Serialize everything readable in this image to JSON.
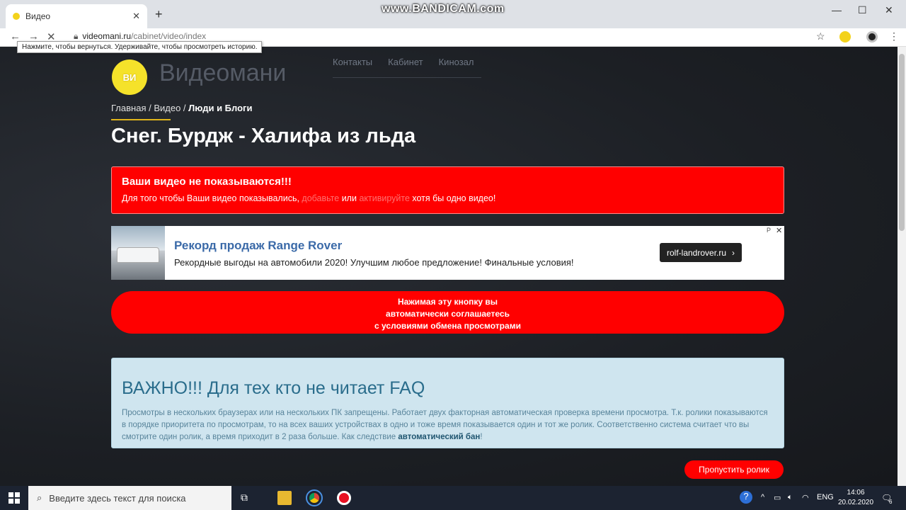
{
  "browser": {
    "tab_title": "Видео",
    "new_tab_icon": "+",
    "watermark": "www.BANDICAM.com",
    "url_host": "videomani.ru",
    "url_path": "/cabinet/video/index",
    "tooltip": "Нажмите, чтобы вернуться. Удерживайте, чтобы просмотреть историю."
  },
  "site": {
    "logo_text": "ВИ",
    "brand": "Видеомани",
    "nav": [
      "Контакты",
      "Кабинет",
      "Кинозал"
    ]
  },
  "breadcrumb": {
    "home": "Главная",
    "sep1": " / ",
    "video": "Видео",
    "sep2": " / ",
    "current": "Люди и Блоги"
  },
  "page_title": "Снег. Бурдж - Халифа из льда",
  "alert": {
    "title": "Ваши видео не показываются!!!",
    "text_start": "Для того чтобы Ваши видео показывались, ",
    "link_add": "добавьте",
    "text_or": " или ",
    "link_activate": "активируйте",
    "text_end": " хотя бы одно видео!"
  },
  "ad": {
    "title": "Рекорд продаж Range Rover",
    "text": "Рекордные выгоды на автомобили 2020! Улучшим любое предложение! Финальные условия!",
    "button": "rolf-landrover.ru",
    "button_arrow": "›",
    "mark": "Р",
    "close": "✕"
  },
  "agree_button": {
    "line1": "Нажимая эту кнопку вы",
    "line2": "автоматически соглашаетесь",
    "line3": "с условиями обмена просмотрами"
  },
  "info": {
    "title": "ВАЖНО!!! Для тех кто не читает FAQ",
    "text": "Просмотры в нескольких браузерах или на нескольких ПК запрещены. Работает двух факторная автоматическая проверка времени просмотра. Т.к. ролики показываются в порядке приоритета по просмотрам, то на всех ваших устройствах в одно и тоже время показывается один и тот же ролик. Соответственно система считает что вы смотрите один ролик, а время приходит в 2 раза больше. Как следствие ",
    "bold": "автоматический бан",
    "end": "!"
  },
  "skip_button": "Пропустить ролик",
  "taskbar": {
    "search_placeholder": "Введите здесь текст для поиска",
    "lang": "ENG",
    "time": "14:06",
    "date": "20.02.2020",
    "notifications": "6"
  },
  "colors": {
    "accent_red": "#ff0000",
    "logo_yellow": "#f5e22a",
    "info_bg": "#cfe5ef",
    "ad_title": "#3b6aa8"
  }
}
